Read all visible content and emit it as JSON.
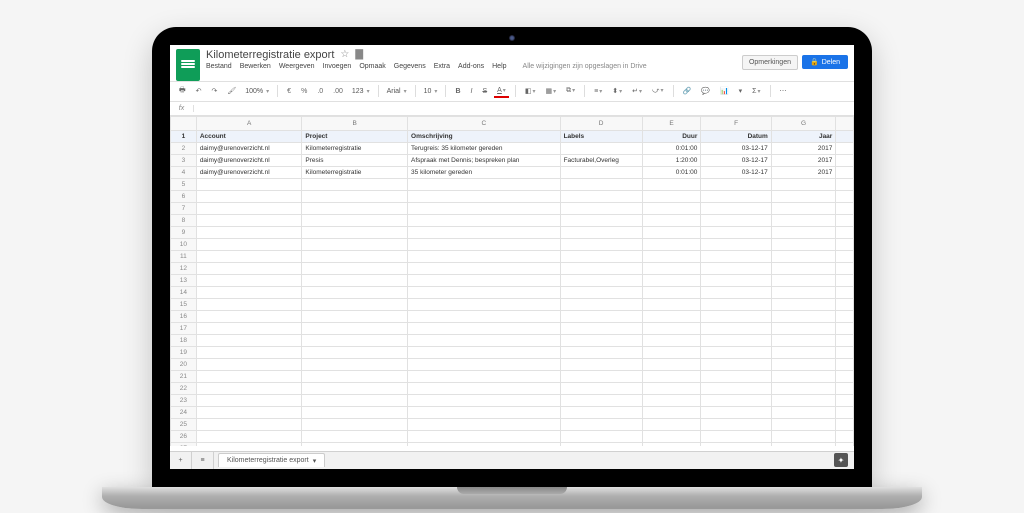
{
  "doc_title": "Kilometerregistratie export",
  "menus": [
    "Bestand",
    "Bewerken",
    "Weergeven",
    "Invoegen",
    "Opmaak",
    "Gegevens",
    "Extra",
    "Add-ons",
    "Help"
  ],
  "save_status": "Alle wijzigingen zijn opgeslagen in Drive",
  "buttons": {
    "comments": "Opmerkingen",
    "share": "Delen"
  },
  "toolbar": {
    "zoom": "100%",
    "number_format": "123",
    "font_name": "Arial",
    "font_size": "10"
  },
  "columns": [
    "A",
    "B",
    "C",
    "D",
    "E",
    "F",
    "G",
    ""
  ],
  "chart_data": {
    "type": "table",
    "headers": [
      "Account",
      "Project",
      "Omschrijving",
      "Labels",
      "Duur",
      "Datum",
      "Jaar"
    ],
    "rows": [
      {
        "Account": "daimy@urenoverzicht.nl",
        "Project": "Kilometerregistratie",
        "Omschrijving": "Terugreis: 35 kilometer gereden",
        "Labels": "",
        "Duur": "0:01:00",
        "Datum": "03-12-17",
        "Jaar": "2017"
      },
      {
        "Account": "daimy@urenoverzicht.nl",
        "Project": "Presis",
        "Omschrijving": "Afspraak met Dennis; bespreken plan",
        "Labels": "Facturabel,Overleg",
        "Duur": "1:20:00",
        "Datum": "03-12-17",
        "Jaar": "2017"
      },
      {
        "Account": "daimy@urenoverzicht.nl",
        "Project": "Kilometerregistratie",
        "Omschrijving": "35 kilometer gereden",
        "Labels": "",
        "Duur": "0:01:00",
        "Datum": "03-12-17",
        "Jaar": "2017"
      }
    ]
  },
  "sheet_tab": "Kilometerregistratie export",
  "total_rows": 29
}
